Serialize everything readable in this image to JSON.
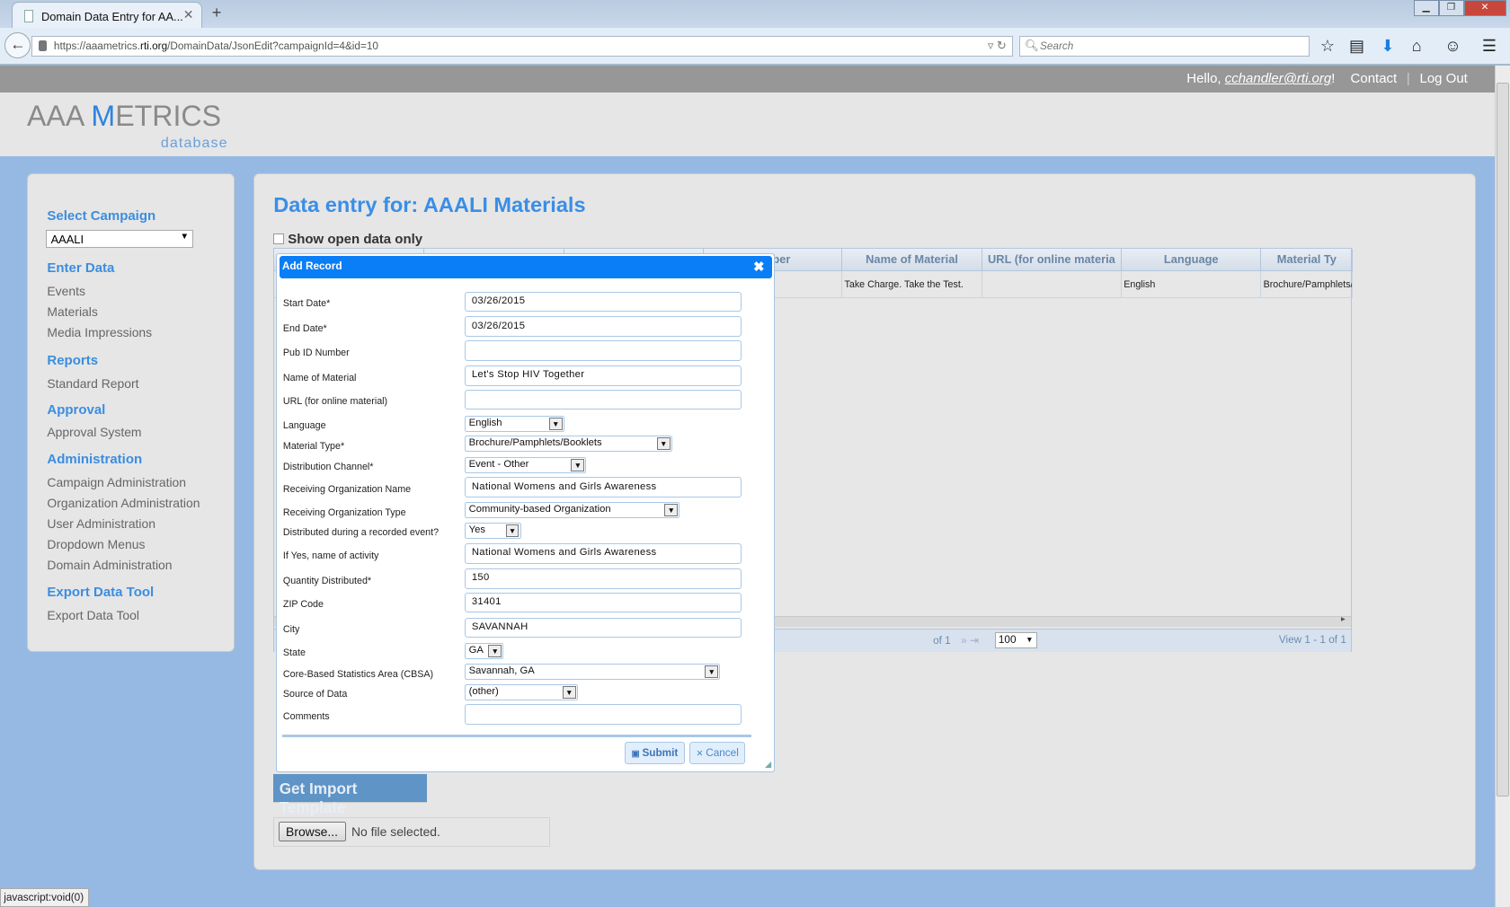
{
  "browser": {
    "tab_title": "Domain Data Entry for AA...",
    "url_prefix": "https://aaametrics.",
    "url_domain": "rti.org",
    "url_path": "/DomainData/JsonEdit?campaignId=4&id=10",
    "search_placeholder": "Search",
    "status_text": "javascript:void(0)"
  },
  "header": {
    "hello": "Hello, ",
    "user": "cchandler@rti.org",
    "excl": "!",
    "contact": "Contact",
    "sep": "|",
    "logout": "Log Out"
  },
  "logo": {
    "text": "AAA METRICS",
    "sub": "database"
  },
  "sidebar": {
    "select_campaign": "Select Campaign",
    "campaign": "AAALI",
    "sections": [
      {
        "title": "Enter Data",
        "items": [
          "Events",
          "Materials",
          "Media Impressions"
        ]
      },
      {
        "title": "Reports",
        "items": [
          "Standard Report"
        ]
      },
      {
        "title": "Approval",
        "items": [
          "Approval System"
        ]
      },
      {
        "title": "Administration",
        "items": [
          "Campaign Administration",
          "Organization Administration",
          "User Administration",
          "Dropdown Menus",
          "Domain Administration"
        ]
      },
      {
        "title": "Export Data Tool",
        "items": [
          "Export Data Tool"
        ]
      }
    ]
  },
  "main": {
    "title": "Data entry for: AAALI Materials",
    "show_open": "Show open data only",
    "grid": {
      "columns": [
        "umber",
        "Name of Material",
        "URL (for online materia",
        "Language",
        "Material Ty"
      ],
      "row": [
        "",
        "Take Charge. Take the Test.",
        "",
        "English",
        "Brochure/Pamphlets/"
      ],
      "pager_of": "of 1",
      "page_size": "100",
      "view": "View 1 - 1 of 1"
    },
    "import_template": "Get Import Template",
    "browse": "Browse...",
    "no_file": "No file selected."
  },
  "dialog": {
    "title": "Add Record",
    "submit": "Submit",
    "cancel": "Cancel",
    "fields": [
      {
        "label": "Start Date*",
        "value": "03/26/2015",
        "type": "text"
      },
      {
        "label": "End Date*",
        "value": "03/26/2015",
        "type": "text"
      },
      {
        "label": "Pub ID Number",
        "value": "",
        "type": "text"
      },
      {
        "label": "Name of Material",
        "value": "Let's Stop HIV Together",
        "type": "text"
      },
      {
        "label": "URL (for online material)",
        "value": "",
        "type": "text"
      },
      {
        "label": "Language",
        "value": "English",
        "type": "select"
      },
      {
        "label": "Material Type*",
        "value": "Brochure/Pamphlets/Booklets",
        "type": "select"
      },
      {
        "label": "Distribution Channel*",
        "value": "Event - Other",
        "type": "select"
      },
      {
        "label": "Receiving Organization Name",
        "value": "National Womens and Girls Awareness",
        "type": "text"
      },
      {
        "label": "Receiving Organization Type",
        "value": "Community-based Organization",
        "type": "select"
      },
      {
        "label": "Distributed during a recorded event?",
        "value": "Yes",
        "type": "select"
      },
      {
        "label": "If Yes, name of activity",
        "value": "National Womens and Girls Awareness",
        "type": "text"
      },
      {
        "label": "Quantity Distributed*",
        "value": "150",
        "type": "text"
      },
      {
        "label": "ZIP Code",
        "value": "31401",
        "type": "text"
      },
      {
        "label": "City",
        "value": "SAVANNAH",
        "type": "text"
      },
      {
        "label": "State",
        "value": "GA",
        "type": "select"
      },
      {
        "label": "Core-Based Statistics Area (CBSA)",
        "value": "Savannah, GA",
        "type": "select"
      },
      {
        "label": "Source of Data",
        "value": "(other)",
        "type": "select"
      },
      {
        "label": "Comments",
        "value": "",
        "type": "text"
      }
    ]
  }
}
